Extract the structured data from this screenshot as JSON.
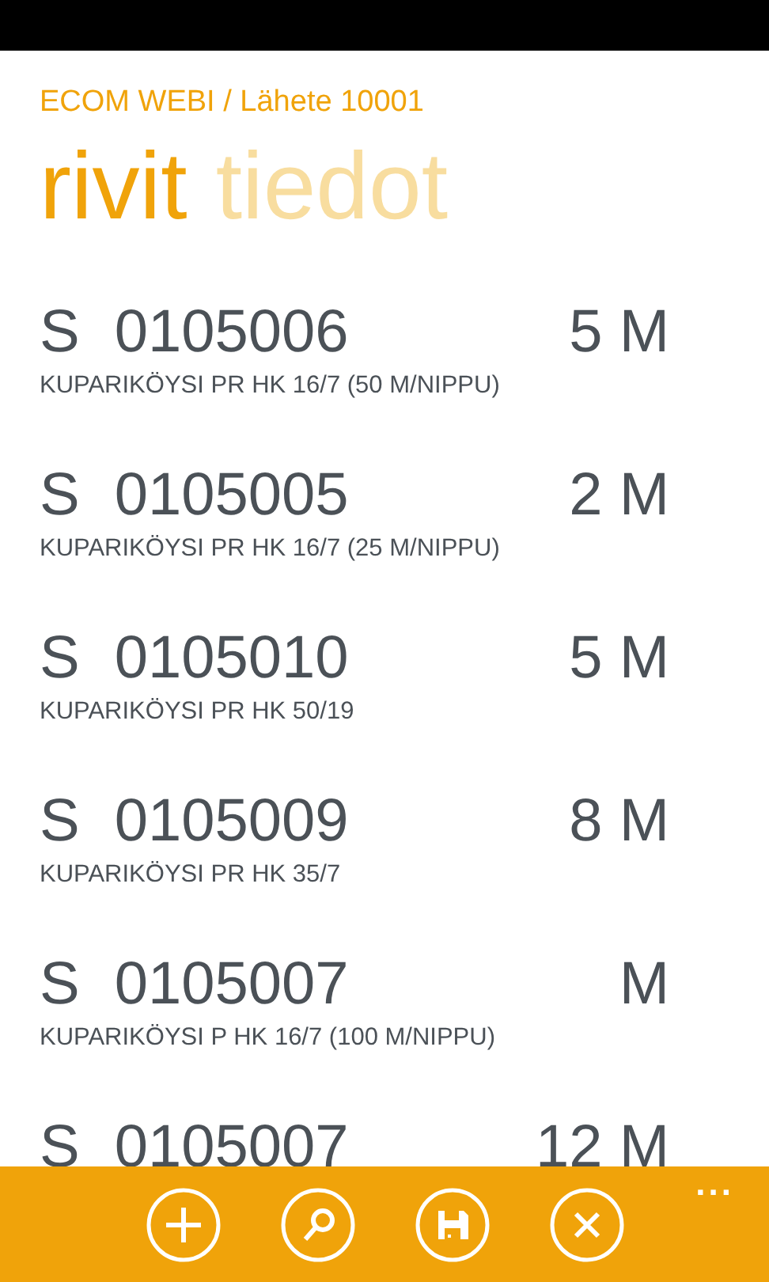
{
  "header": {
    "title": "ECOM WEBI / Lähete 10001"
  },
  "pivots": [
    {
      "label": "rivit",
      "selected": true
    },
    {
      "label": "tiedot",
      "selected": false
    }
  ],
  "rows": [
    {
      "prefix": "S",
      "code": "0105006",
      "quantity": "5 M",
      "description": "KUPARIKÖYSI PR HK 16/7 (50 M/NIPPU)"
    },
    {
      "prefix": "S",
      "code": "0105005",
      "quantity": "2 M",
      "description": "KUPARIKÖYSI PR HK 16/7 (25 M/NIPPU)"
    },
    {
      "prefix": "S",
      "code": "0105010",
      "quantity": "5 M",
      "description": "KUPARIKÖYSI PR HK 50/19"
    },
    {
      "prefix": "S",
      "code": "0105009",
      "quantity": "8 M",
      "description": "KUPARIKÖYSI PR HK 35/7"
    },
    {
      "prefix": "S",
      "code": "0105007",
      "quantity": "M",
      "description": "KUPARIKÖYSI P HK 16/7 (100 M/NIPPU)"
    },
    {
      "prefix": "S",
      "code": "0105007",
      "quantity": "12 M"
    }
  ],
  "app_bar": {
    "buttons": [
      {
        "kind": "add"
      },
      {
        "kind": "search"
      },
      {
        "kind": "save"
      },
      {
        "kind": "cancel"
      }
    ],
    "more": "..."
  }
}
